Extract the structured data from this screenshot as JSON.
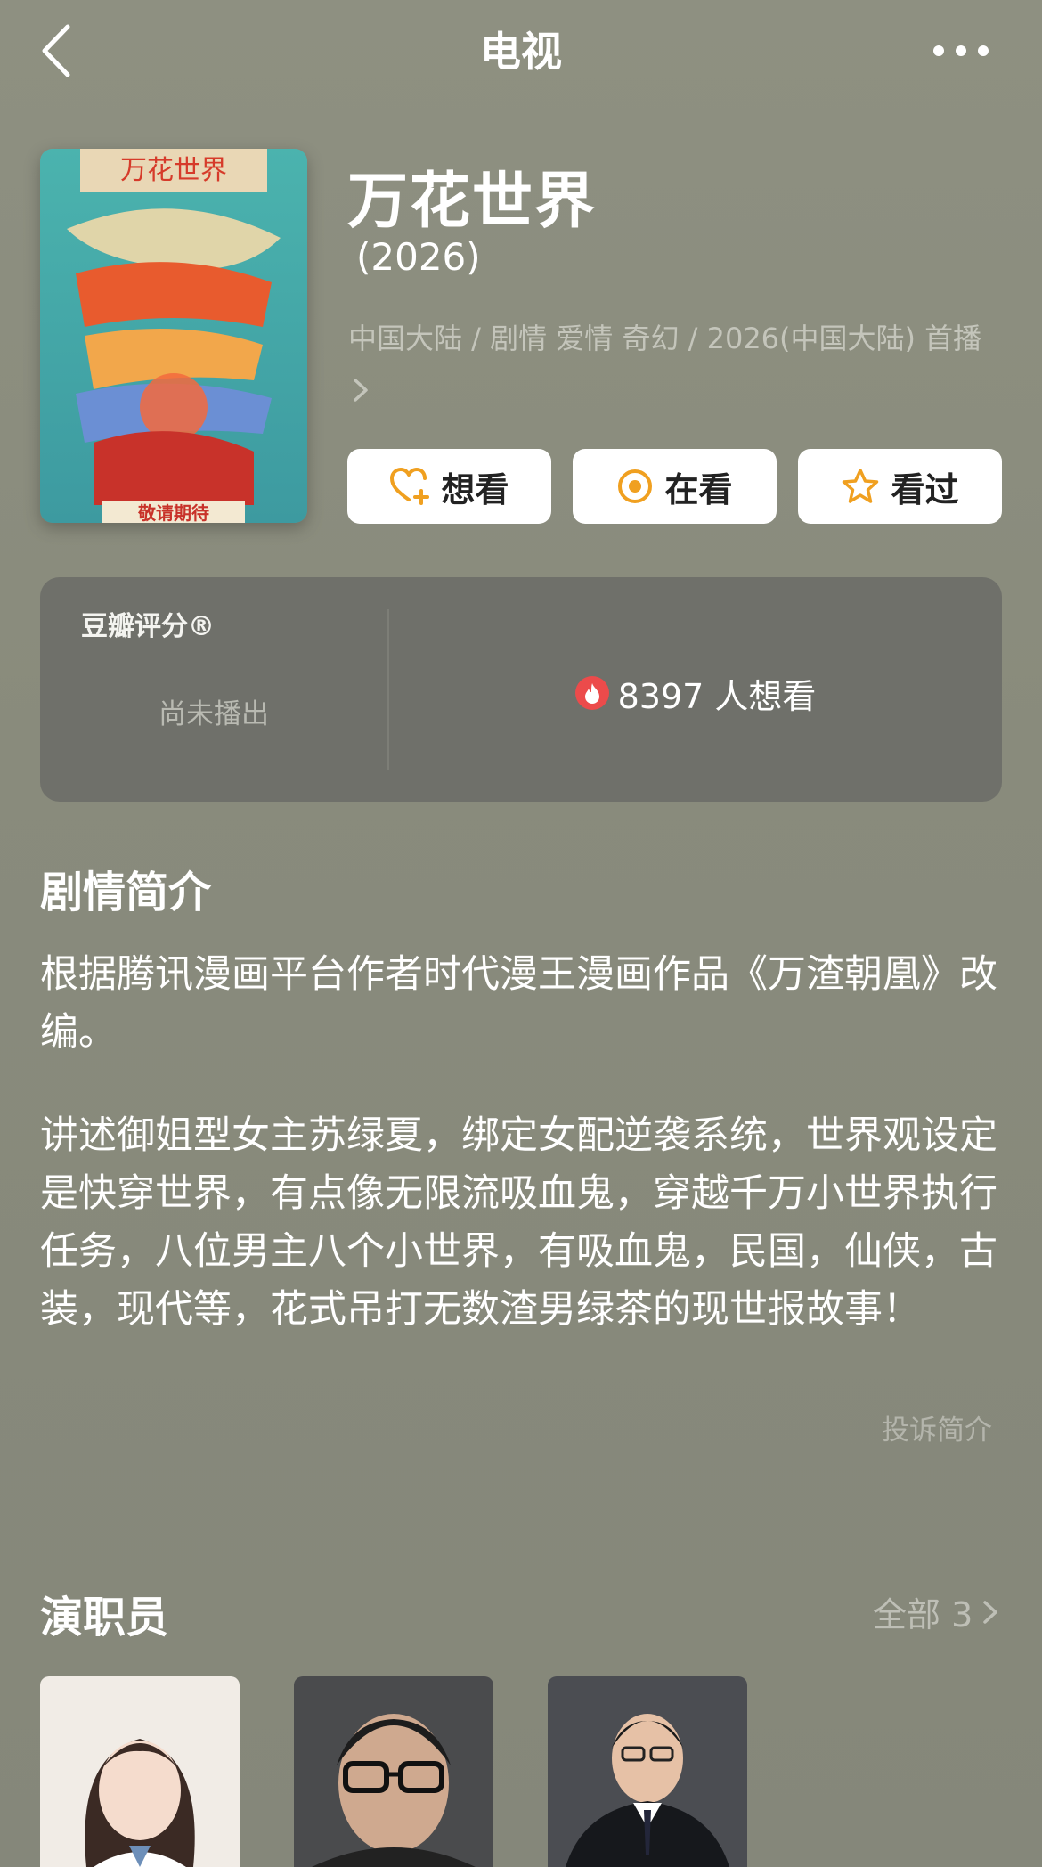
{
  "nav": {
    "title": "电视"
  },
  "show": {
    "title": "万花世界",
    "year": "(2026)",
    "meta": "中国大陆 / 剧情 爱情 奇幻 / 2026(中国大陆) 首播",
    "poster_text": "万花世界",
    "poster_caption": "敬请期待"
  },
  "actions": [
    {
      "label": "想看",
      "icon": "heart-plus-icon"
    },
    {
      "label": "在看",
      "icon": "target-icon"
    },
    {
      "label": "看过",
      "icon": "star-icon"
    }
  ],
  "rating": {
    "label": "豆瓣评分®",
    "status": "尚未播出",
    "wish_text": "8397 人想看"
  },
  "synopsis": {
    "title": "剧情简介",
    "paragraphs": [
      "根据腾讯漫画平台作者时代漫王漫画作品《万渣朝凰》改编。",
      "讲述御姐型女主苏绿夏，绑定女配逆袭系统，世界观设定是快穿世界，有点像无限流吸血鬼，穿越千万小世界执行任务，八位男主八个小世界，有吸血鬼，民国，仙侠，古装，现代等，花式吊打无数渣男绿茶的现世报故事！"
    ],
    "report_label": "投诉简介"
  },
  "cast": {
    "title": "演职员",
    "all_label": "全部 3"
  },
  "colors": {
    "accent": "#f0a020",
    "card_bg": "#6f706a",
    "fire": "#ec4b4b"
  }
}
